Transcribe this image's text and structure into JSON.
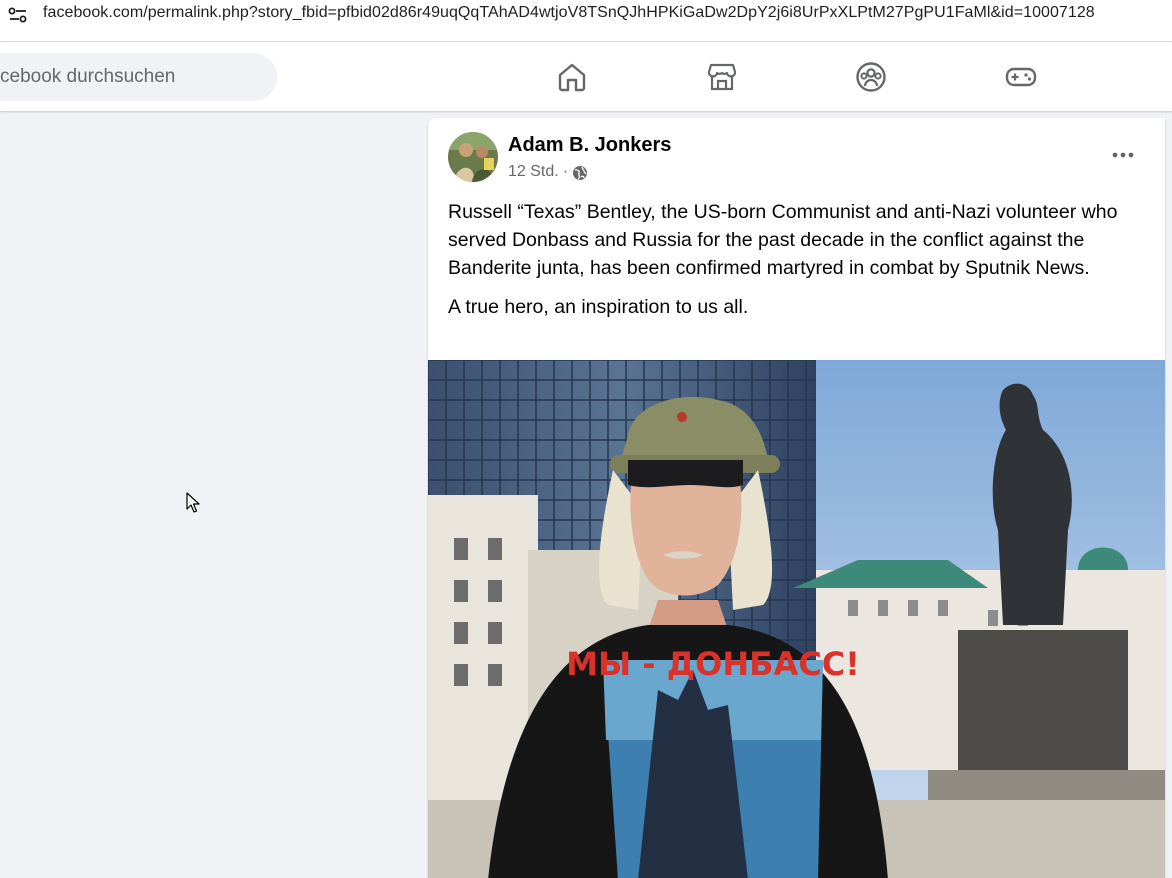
{
  "browser": {
    "url": "facebook.com/permalink.php?story_fbid=pfbid02d86r49uqQqTAhAD4wtjoV8TSnQJhHPKiGaDw2DpY2j6i8UrPxXLPtM27PgPU1FaMl&id=10007128"
  },
  "header": {
    "search_placeholder": "cebook durchsuchen",
    "nav": [
      {
        "icon": "home-icon"
      },
      {
        "icon": "marketplace-icon"
      },
      {
        "icon": "groups-icon"
      },
      {
        "icon": "gaming-icon"
      }
    ]
  },
  "post": {
    "author": "Adam B. Jonkers",
    "time": "12 Std.",
    "separator": "·",
    "audience_icon": "globe-icon",
    "paragraphs": [
      "Russell “Texas” Bentley, the US-born Communist and anti-Nazi volunteer who served Donbass and Russia for the past decade in the conflict against the Banderite junta, has been confirmed martyred in combat by Sputnik News.",
      "A true hero, an inspiration to us all."
    ],
    "photo": {
      "shirt_text": "МЫ - ДОНБАСС!"
    }
  },
  "colors": {
    "page_bg": "#f0f2f5",
    "icon_gray": "#65676b",
    "text": "#050505"
  }
}
